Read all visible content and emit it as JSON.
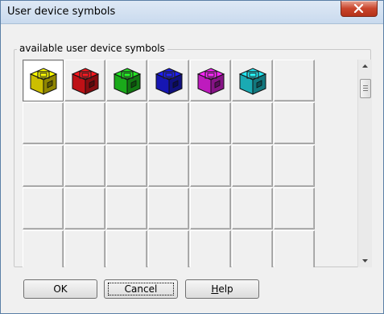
{
  "window": {
    "title": "User device symbols"
  },
  "group": {
    "label": "available user device symbols"
  },
  "grid": {
    "columns": 7,
    "rows": 5,
    "selected_index": 0,
    "symbols": [
      {
        "name": "yellow-device-symbol",
        "color": "#f0e000"
      },
      {
        "name": "red-device-symbol",
        "color": "#e0141a"
      },
      {
        "name": "green-device-symbol",
        "color": "#1ec81e"
      },
      {
        "name": "blue-device-symbol",
        "color": "#1a1ad2"
      },
      {
        "name": "magenta-device-symbol",
        "color": "#e020e0"
      },
      {
        "name": "cyan-device-symbol",
        "color": "#1ec8d2"
      }
    ]
  },
  "buttons": {
    "ok_label": "OK",
    "cancel_label": "Cancel",
    "help_label": "Help",
    "help_mnemonic": "H",
    "help_rest": "elp"
  },
  "icons": {
    "close": "close-icon",
    "scroll_up": "arrow-up-icon",
    "scroll_down": "arrow-down-icon"
  }
}
